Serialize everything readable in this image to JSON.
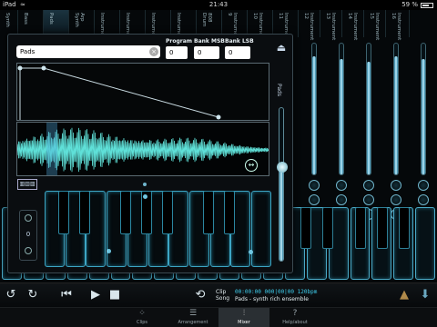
{
  "status": {
    "device": "iPad",
    "time": "21:43",
    "battery": "59 %"
  },
  "tracks": [
    "Synth",
    "Bass",
    "Pads",
    "Arp Synth",
    "Instrument",
    "Instrument",
    "Instrument",
    "Instrument",
    "808 Drum",
    "Instrument 9",
    "Instrument 10",
    "Instrument 11",
    "Instrument 12",
    "Instrument 13",
    "Instrument 14",
    "Instrument 15",
    "Instrument 16"
  ],
  "mixer_channels": [
    {
      "name": "Instrument 12",
      "level": 0.9
    },
    {
      "name": "Instrument 13",
      "level": 0.88
    },
    {
      "name": "Instrument 14",
      "level": 0.86
    },
    {
      "name": "Instrument 15",
      "level": 0.9
    },
    {
      "name": "Instrument 16",
      "level": 0.88
    }
  ],
  "panel": {
    "preset_value": "Pads",
    "program": {
      "label": "Program",
      "value": "0"
    },
    "bank_msb": {
      "label": "Bank MSB",
      "value": "0"
    },
    "bank_lsb": {
      "label": "Bank LSB",
      "value": "0"
    },
    "keyboard_label": "keyboard",
    "octave_value": "0",
    "volume_label": "Pads",
    "volume_level": 0.62
  },
  "transport": {
    "clip_label": "Clip",
    "song_label": "Song",
    "timecode": "00:00:00  000|00|00  120bpm",
    "song_name": "Pads - synth rich ensemble"
  },
  "tabs": [
    {
      "label": "Clips",
      "icon": "clips-icon",
      "active": false
    },
    {
      "label": "Arrangement",
      "icon": "arrangement-icon",
      "active": false
    },
    {
      "label": "Mixer",
      "icon": "mixer-icon",
      "active": true
    },
    {
      "label": "Help/about",
      "icon": "help-icon",
      "active": false
    }
  ],
  "colors": {
    "accent": "#3fd0f0",
    "fader": "#bfefff"
  }
}
